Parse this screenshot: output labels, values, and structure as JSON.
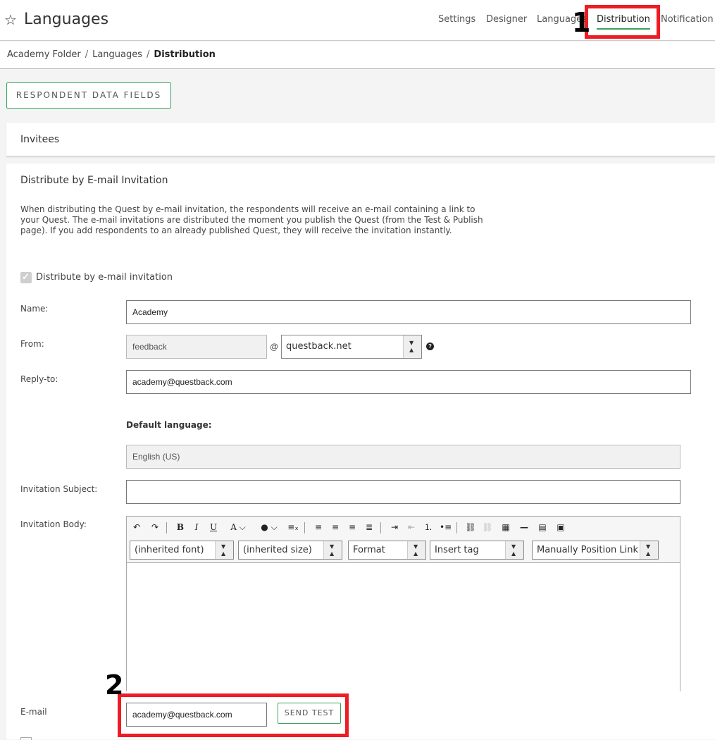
{
  "header": {
    "title": "Languages",
    "tabs": [
      "Settings",
      "Designer",
      "Languages",
      "Distribution",
      "Notification"
    ],
    "active_tab": "Distribution"
  },
  "breadcrumb": [
    "Academy Folder",
    "Languages",
    "Distribution"
  ],
  "annotations": {
    "one": "1",
    "two": "2",
    "color": "#ee1c24"
  },
  "respondent_button": "RESPONDENT DATA FIELDS",
  "invitees_title": "Invitees",
  "section": {
    "title": "Distribute by E-mail Invitation",
    "description": "When distributing the Quest by e-mail invitation, the respondents will receive an e-mail containing a link to your Quest. The e-mail invitations are distributed the moment you publish the Quest (from the Test & Publish page). If you add respondents to an already published Quest, they will receive the invitation instantly.",
    "checkbox_label": "Distribute by e-mail invitation",
    "checkbox_checked": true
  },
  "form": {
    "name_label": "Name:",
    "name_value": "Academy",
    "from_label": "From:",
    "from_user": "feedback",
    "at": "@",
    "from_domain": "questback.net",
    "reply_label": "Reply-to:",
    "reply_value": "academy@questback.com",
    "default_language_label": "Default language:",
    "default_language_value": "English (US)",
    "subject_label": "Invitation Subject:",
    "subject_value": "",
    "body_label": "Invitation Body:",
    "email_label": "E-mail",
    "email_value": "academy@questback.com",
    "send_test": "SEND TEST"
  },
  "editor": {
    "font": "(inherited font)",
    "size": "(inherited size)",
    "format": "Format",
    "insert_tag": "Insert tag",
    "position_link": "Manually Position Link",
    "icons": [
      "undo-icon",
      "redo-icon",
      "bold-icon",
      "italic-icon",
      "underline-icon",
      "font-color-icon",
      "bg-color-icon",
      "clear-format-icon",
      "align-left-icon",
      "align-center-icon",
      "align-right-icon",
      "justify-icon",
      "indent-icon",
      "outdent-icon",
      "ordered-list-icon",
      "bullet-list-icon",
      "link-icon",
      "unlink-icon",
      "table-icon",
      "hr-icon",
      "source-icon",
      "image-icon"
    ]
  },
  "accent_color": "#3aa35b"
}
